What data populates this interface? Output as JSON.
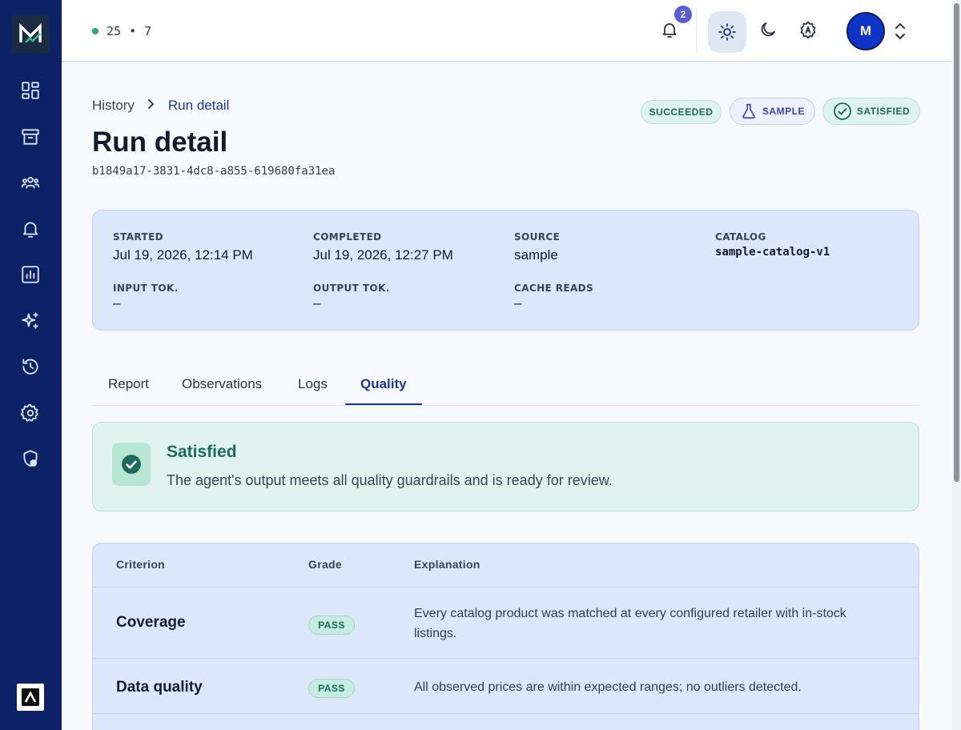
{
  "header": {
    "status_primary": "25",
    "status_separator": "•",
    "status_secondary": "7",
    "notification_count": "2",
    "avatar_initial": "M"
  },
  "breadcrumb": {
    "parent": "History",
    "current": "Run detail"
  },
  "page": {
    "title": "Run detail",
    "run_id": "b1849a17-3831-4dc8-a855-619680fa31ea"
  },
  "status_pills": {
    "succeeded": "SUCCEEDED",
    "sample": "SAMPLE",
    "satisfied": "SATISFIED"
  },
  "meta": {
    "started_label": "STARTED",
    "started_value": "Jul 19, 2026, 12:14 PM",
    "completed_label": "COMPLETED",
    "completed_value": "Jul 19, 2026, 12:27 PM",
    "source_label": "SOURCE",
    "source_value": "sample",
    "catalog_label": "CATALOG",
    "catalog_value": "sample-catalog-v1",
    "input_tok_label": "INPUT TOK.",
    "input_tok_value": "–",
    "output_tok_label": "OUTPUT TOK.",
    "output_tok_value": "–",
    "cache_reads_label": "CACHE READS",
    "cache_reads_value": "–"
  },
  "tabs": [
    {
      "label": "Report"
    },
    {
      "label": "Observations"
    },
    {
      "label": "Logs"
    },
    {
      "label": "Quality"
    }
  ],
  "active_tab": "Quality",
  "result": {
    "title": "Satisfied",
    "description": "The agent's output meets all quality guardrails and is ready for review."
  },
  "table": {
    "columns": [
      "Criterion",
      "Grade",
      "Explanation"
    ],
    "rows": [
      {
        "criterion": "Coverage",
        "grade": "PASS",
        "explanation": "Every catalog product was matched at every configured retailer with in-stock listings."
      },
      {
        "criterion": "Data quality",
        "grade": "PASS",
        "explanation": "All observed prices are within expected ranges; no outliers detected."
      }
    ]
  },
  "colors": {
    "sidebar_bg": "#0d2266",
    "accent": "#1b3796",
    "success": "#1c6b58",
    "card_bg": "#dde7fb"
  }
}
